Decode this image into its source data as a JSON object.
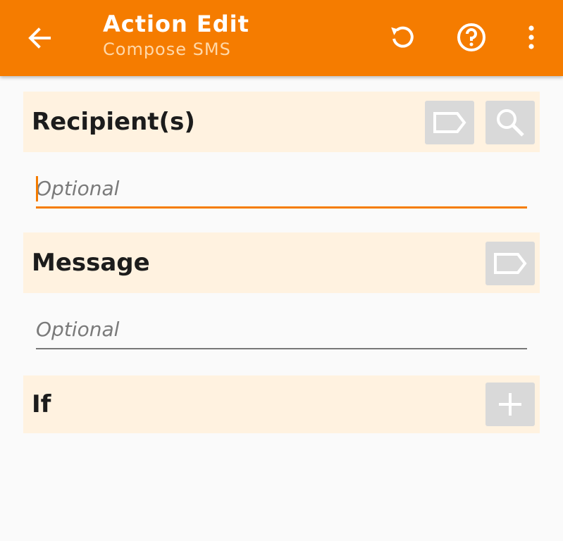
{
  "colors": {
    "accent": "#f57c00",
    "section_bg": "#fff2e0",
    "button_bg": "#d9d9d9"
  },
  "app_bar": {
    "title": "Action Edit",
    "subtitle": "Compose SMS",
    "icons": [
      "arrow-back-icon",
      "undo-icon",
      "help-icon",
      "more-vert-icon"
    ]
  },
  "recipient": {
    "label": "Recipient(s)",
    "placeholder": "Optional",
    "value": "",
    "icons": [
      "tag-icon",
      "search-icon"
    ]
  },
  "message": {
    "label": "Message",
    "placeholder": "Optional",
    "value": "",
    "icons": [
      "tag-icon"
    ]
  },
  "condition": {
    "label": "If",
    "icons": [
      "plus-icon"
    ]
  }
}
